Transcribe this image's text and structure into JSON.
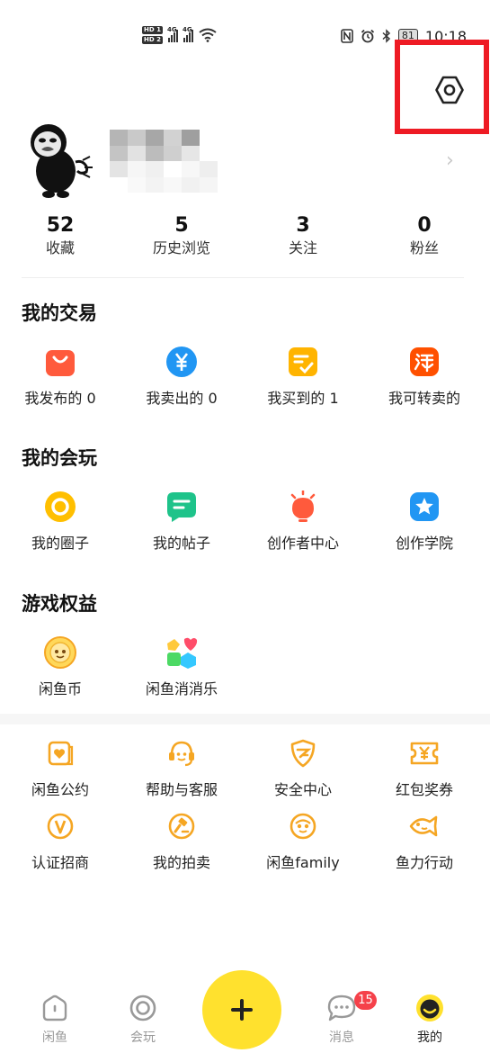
{
  "status_bar": {
    "hd1": "HD 1",
    "hd2": "HD 2",
    "net1": "4G",
    "net2": "4G",
    "battery": "81",
    "time": "10:18"
  },
  "profile": {
    "chevron": "›"
  },
  "stats": [
    {
      "value": "52",
      "label": "收藏"
    },
    {
      "value": "5",
      "label": "历史浏览"
    },
    {
      "value": "3",
      "label": "关注"
    },
    {
      "value": "0",
      "label": "粉丝"
    }
  ],
  "trade": {
    "title": "我的交易",
    "items": [
      {
        "label": "我发布的 0",
        "icon": "shopping-bag-icon"
      },
      {
        "label": "我卖出的 0",
        "icon": "yen-icon"
      },
      {
        "label": "我买到的 1",
        "icon": "check-note-icon"
      },
      {
        "label": "我可转卖的",
        "icon": "taobao-icon"
      }
    ]
  },
  "play": {
    "title": "我的会玩",
    "items": [
      {
        "label": "我的圈子",
        "icon": "circle-icon"
      },
      {
        "label": "我的帖子",
        "icon": "post-icon"
      },
      {
        "label": "创作者中心",
        "icon": "bulb-icon"
      },
      {
        "label": "创作学院",
        "icon": "star-icon"
      }
    ]
  },
  "game": {
    "title": "游戏权益",
    "items": [
      {
        "label": "闲鱼币",
        "icon": "fish-coin-icon"
      },
      {
        "label": "闲鱼消消乐",
        "icon": "match-game-icon"
      }
    ]
  },
  "services": [
    {
      "label": "闲鱼公约",
      "icon": "heart-doc-icon"
    },
    {
      "label": "帮助与客服",
      "icon": "headset-icon"
    },
    {
      "label": "安全中心",
      "icon": "shield-icon"
    },
    {
      "label": "红包奖券",
      "icon": "ticket-icon"
    },
    {
      "label": "认证招商",
      "icon": "verified-icon"
    },
    {
      "label": "我的拍卖",
      "icon": "gavel-icon"
    },
    {
      "label": "闲鱼family",
      "icon": "family-icon"
    },
    {
      "label": "鱼力行动",
      "icon": "fish-icon"
    }
  ],
  "nav": {
    "home": "闲鱼",
    "play": "会玩",
    "publish": "+",
    "messages": "消息",
    "messages_badge": "15",
    "me": "我的"
  },
  "colors": {
    "accent_yellow": "#FFE12E",
    "icon_orange": "#F5A623",
    "highlight_red": "#EE1B24",
    "badge_red": "#F5414A"
  }
}
